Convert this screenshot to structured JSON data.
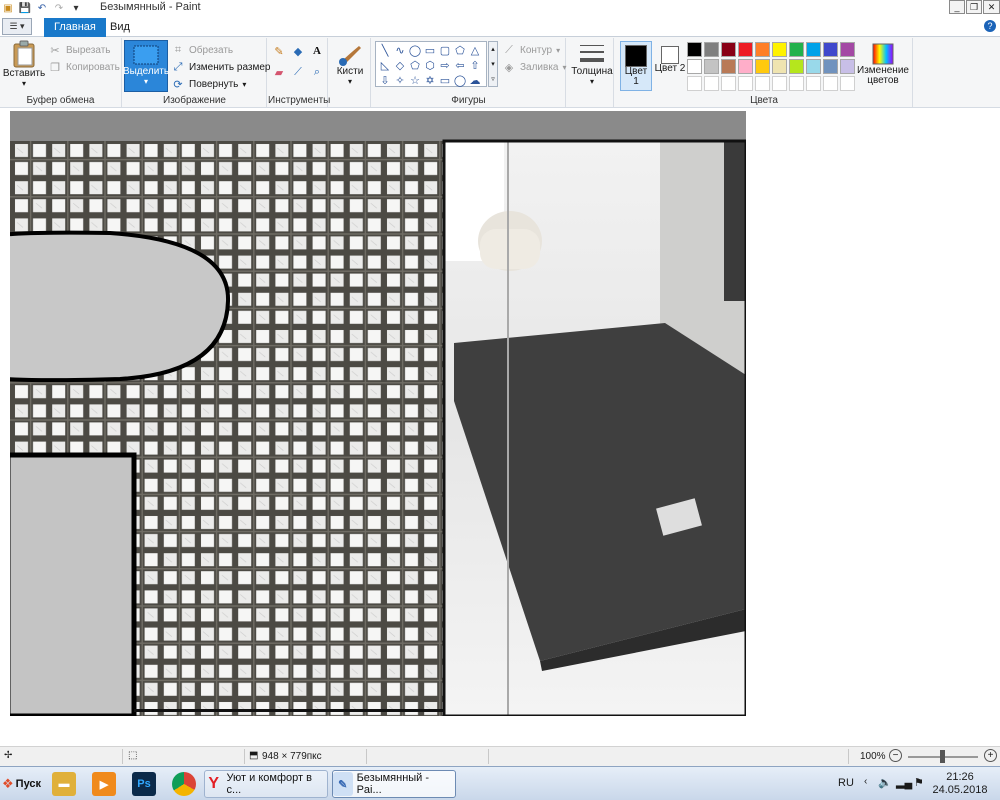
{
  "window": {
    "title": "Безымянный - Paint",
    "buttons": {
      "minimize": "_",
      "maximize": "❐",
      "close": "✕"
    }
  },
  "tabs": [
    {
      "label": "Главная",
      "active": true
    },
    {
      "label": "Вид",
      "active": false
    }
  ],
  "ribbon": {
    "clipboard": {
      "group_label": "Буфер обмена",
      "paste": "Вставить",
      "cut": "Вырезать",
      "copy": "Копировать"
    },
    "image": {
      "group_label": "Изображение",
      "select": "Выделить",
      "crop": "Обрезать",
      "resize": "Изменить размер",
      "rotate": "Повернуть"
    },
    "tools": {
      "group_label": "Инструменты"
    },
    "brushes": {
      "label": "Кисти"
    },
    "shapes": {
      "group_label": "Фигуры",
      "outline": "Контур",
      "fill": "Заливка"
    },
    "size": {
      "label": "Толщина"
    },
    "colors": {
      "group_label": "Цвета",
      "color1": "Цвет 1",
      "color2": "Цвет 2",
      "edit_colors": "Изменение цветов",
      "color1_value": "#000000",
      "color2_value": "#ffffff",
      "palette_row1": [
        "#000000",
        "#7f7f7f",
        "#880015",
        "#ed1c24",
        "#ff7f27",
        "#fff200",
        "#22b14c",
        "#00a2e8",
        "#3f48cc",
        "#a349a4"
      ],
      "palette_row2": [
        "#ffffff",
        "#c3c3c3",
        "#b97a57",
        "#ffaec9",
        "#ffc90e",
        "#efe4b0",
        "#b5e61d",
        "#99d9ea",
        "#7092be",
        "#c8bfe7"
      ]
    }
  },
  "statusbar": {
    "dimensions": "948 × 779пкс",
    "zoom": "100%"
  },
  "taskbar": {
    "start": "Пуск",
    "apps": [
      {
        "name": "explorer",
        "label": ""
      },
      {
        "name": "media-player",
        "label": ""
      },
      {
        "name": "photoshop",
        "label": "Ps"
      },
      {
        "name": "chrome",
        "label": ""
      },
      {
        "name": "yandex-browser",
        "label": "Уют и комфорт в с..."
      },
      {
        "name": "paint",
        "label": "Безымянный - Pai..."
      }
    ],
    "language": "RU",
    "time": "21:26",
    "date": "24.05.2018"
  }
}
